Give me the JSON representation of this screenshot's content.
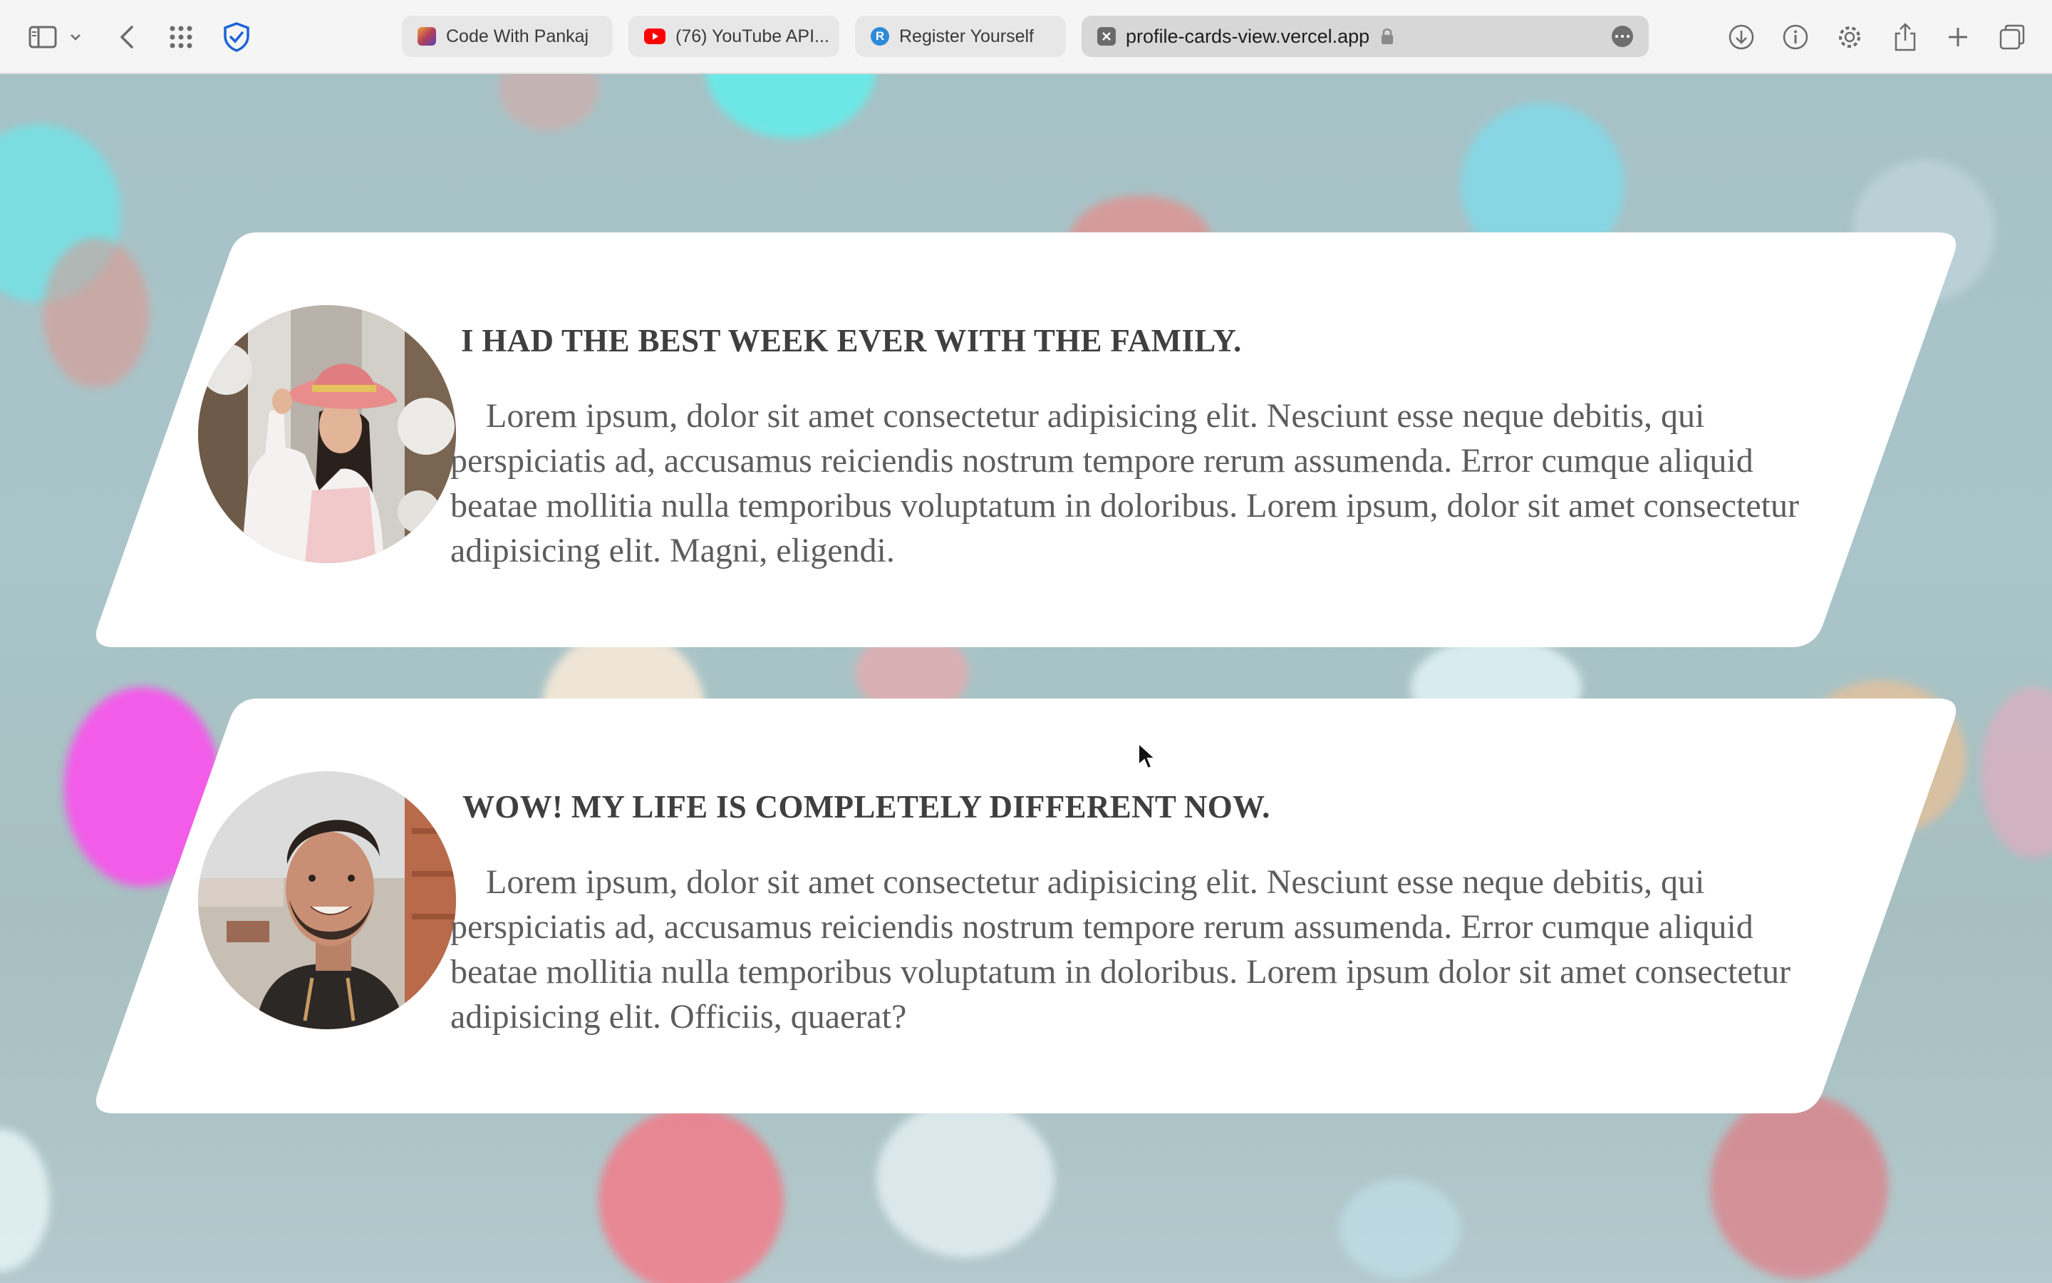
{
  "browser": {
    "tabs": [
      {
        "label": "Code With Pankaj",
        "favicon": "pankaj-favicon",
        "color": "#b3405a"
      },
      {
        "label": "(76) YouTube API...",
        "favicon": "youtube-favicon",
        "color": "#ff0000"
      },
      {
        "label": "Register Yourself",
        "favicon": "register-favicon",
        "color": "#2f8ad8"
      },
      {
        "label": "profile-cards-view.vercel.app",
        "favicon": "page-favicon",
        "color": "#5a5a5a",
        "active": true
      }
    ],
    "toolbar_icons": [
      "sidebar-icon",
      "chevron-down-icon",
      "back-icon",
      "grid-icon",
      "shield-icon",
      "download-icon",
      "info-icon",
      "gear-icon",
      "share-icon",
      "plus-icon",
      "tabs-overview-icon"
    ]
  },
  "cards": [
    {
      "title": "I HAD THE BEST WEEK EVER WITH THE FAMILY.",
      "text": "Lorem ipsum, dolor sit amet consectetur adipisicing elit. Nesciunt esse neque debitis, qui perspiciatis ad, accusamus reiciendis nostrum tempore rerum assumenda. Error cumque aliquid beatae mollitia nulla temporibus voluptatum in doloribus. Lorem ipsum, dolor sit amet consectetur adipisicing elit. Magni, eligendi.",
      "avatar": "woman-with-pink-hat-photo"
    },
    {
      "title": "WOW! MY LIFE IS COMPLETELY DIFFERENT NOW.",
      "text": "Lorem ipsum, dolor sit amet consectetur adipisicing elit. Nesciunt esse neque debitis, qui perspiciatis ad, accusamus reiciendis nostrum tempore rerum assumenda. Error cumque aliquid beatae mollitia nulla temporibus voluptatum in doloribus. Lorem ipsum dolor sit amet consectetur adipisicing elit. Officiis, quaerat?",
      "avatar": "smiling-bearded-man-photo"
    }
  ],
  "colors": {
    "card": "#ffffff",
    "title": "#3f3f3f",
    "text": "#5d5d5d",
    "toolbar": "#f6f5f5"
  }
}
